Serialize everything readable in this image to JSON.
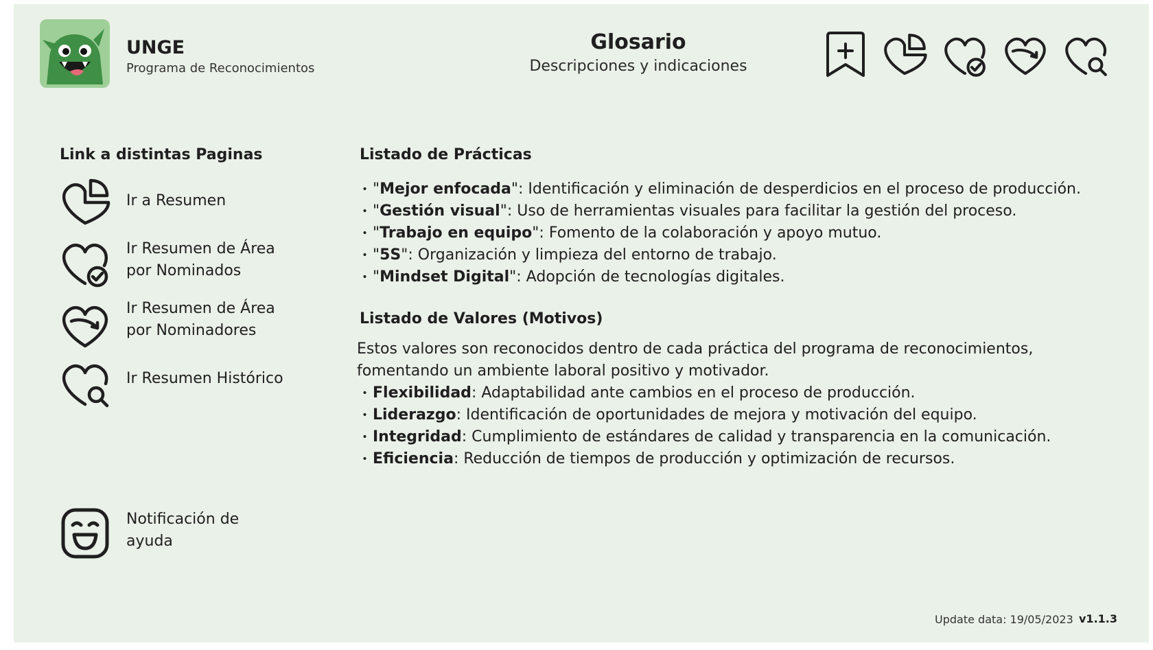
{
  "header": {
    "brand_name": "UNGE",
    "brand_subtitle": "Programa de Reconocimientos",
    "title": "Glosario",
    "subtitle": "Descripciones y indicaciones",
    "icons": [
      "bookmark-plus-icon",
      "heart-chart-icon",
      "heart-check-icon",
      "heart-refresh-icon",
      "heart-search-icon"
    ]
  },
  "nav": {
    "heading": "Link a distintas Paginas",
    "items": [
      {
        "icon": "heart-chart-icon",
        "label": "Ir a Resumen"
      },
      {
        "icon": "heart-check-icon",
        "label_line1": "Ir Resumen de Área",
        "label_line2": "por Nominados"
      },
      {
        "icon": "heart-refresh-icon",
        "label_line1": "Ir Resumen de Área",
        "label_line2": "por Nominadores"
      },
      {
        "icon": "heart-search-icon",
        "label": "Ir Resumen Histórico"
      }
    ],
    "help": {
      "icon": "smiley-face-icon",
      "label_line1": "Notificación de",
      "label_line2": "ayuda"
    }
  },
  "practices": {
    "heading": "Listado de Prácticas",
    "items": [
      {
        "term": "Mejor enfocada",
        "desc": ": Identificación y eliminación de desperdicios en el proceso de producción."
      },
      {
        "term": "Gestión visual",
        "desc": ": Uso de herramientas visuales para facilitar la gestión del proceso."
      },
      {
        "term": "Trabajo en equipo",
        "desc": ": Fomento de la colaboración y apoyo mutuo."
      },
      {
        "term": "5S",
        "desc": ": Organización y limpieza del entorno de trabajo."
      },
      {
        "term": "Mindset Digital",
        "desc": ": Adopción de tecnologías digitales."
      }
    ]
  },
  "values": {
    "heading": "Listado de Valores (Motivos)",
    "intro_line1": "Estos valores son reconocidos dentro de cada práctica del programa de reconocimientos,",
    "intro_line2": "fomentando un ambiente laboral positivo y motivador.",
    "items": [
      {
        "term": "Flexibilidad",
        "desc": ": Adaptabilidad ante cambios en el proceso de producción."
      },
      {
        "term": "Liderazgo",
        "desc": ": Identificación de oportunidades de mejora y motivación del equipo."
      },
      {
        "term": "Integridad",
        "desc": ": Cumplimiento de estándares de calidad y transparencia en la comunicación."
      },
      {
        "term": "Eficiencia",
        "desc": ": Reducción de tiempos de producción y optimización de recursos."
      }
    ]
  },
  "footer": {
    "update": "Update data: 19/05/2023",
    "version": "v1.1.3"
  },
  "colors": {
    "background": "#eaf1e8",
    "logo_bg": "#9fcf98",
    "monster": "#3f8f46",
    "ink": "#1f1f1f"
  }
}
